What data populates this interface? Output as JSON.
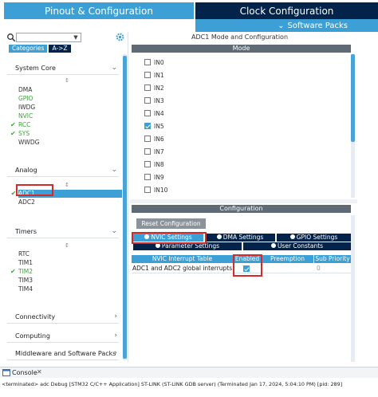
{
  "header": {
    "pinout_tab": "Pinout & Configuration",
    "clock_tab": "Clock Configuration",
    "software_packs": "Software Packs"
  },
  "sidebar": {
    "search_value": "",
    "category_tabs": [
      "Categories",
      "A->Z"
    ],
    "sections": {
      "system_core": {
        "label": "System Core",
        "items": [
          "DMA",
          "GPIO",
          "IWDG",
          "NVIC",
          "RCC",
          "SYS",
          "WWDG"
        ]
      },
      "analog": {
        "label": "Analog",
        "items": [
          "ADC1",
          "ADC2"
        ]
      },
      "timers": {
        "label": "Timers",
        "items": [
          "RTC",
          "TIM1",
          "TIM2",
          "TIM3",
          "TIM4"
        ]
      },
      "connectivity": {
        "label": "Connectivity"
      },
      "computing": {
        "label": "Computing"
      },
      "middleware": {
        "label": "Middleware and Software Packs"
      }
    }
  },
  "main": {
    "title": "ADC1 Mode and Configuration",
    "mode_header": "Mode",
    "inputs": [
      {
        "label": "IN0",
        "checked": false
      },
      {
        "label": "IN1",
        "checked": false
      },
      {
        "label": "IN2",
        "checked": false
      },
      {
        "label": "IN3",
        "checked": false
      },
      {
        "label": "IN4",
        "checked": false
      },
      {
        "label": "IN5",
        "checked": true
      },
      {
        "label": "IN6",
        "checked": false
      },
      {
        "label": "IN7",
        "checked": false
      },
      {
        "label": "IN8",
        "checked": false
      },
      {
        "label": "IN9",
        "checked": false
      },
      {
        "label": "IN10",
        "checked": false
      }
    ],
    "configuration_header": "Configuration",
    "reset_button": "Reset Configuration",
    "config_tabs": [
      "NVIC Settings",
      "DMA Settings",
      "GPIO Settings",
      "Parameter Settings",
      "User Constants"
    ],
    "table_headers": [
      "NVIC Interrupt Table",
      "Enabled",
      "Preemption Priority",
      "Sub Priority"
    ],
    "table_rows": [
      {
        "name": "ADC1 and ADC2 global interrupts",
        "enabled": true,
        "preemption": "",
        "sub": "0"
      }
    ]
  },
  "console": {
    "tab_label": "Console",
    "text": "<terminated> adc Debug [STM32 C/C++ Application] ST-LINK (ST-LINK GDB server) (Terminated Jan 17, 2024, 5:04:10 PM) [pid: 289]"
  },
  "colors": {
    "accent_blue": "#3c9fd6",
    "navy": "#03234b",
    "header_gray": "#5e6a75",
    "highlight_red": "#d32a2a",
    "enabled_green": "#3ea23e"
  }
}
